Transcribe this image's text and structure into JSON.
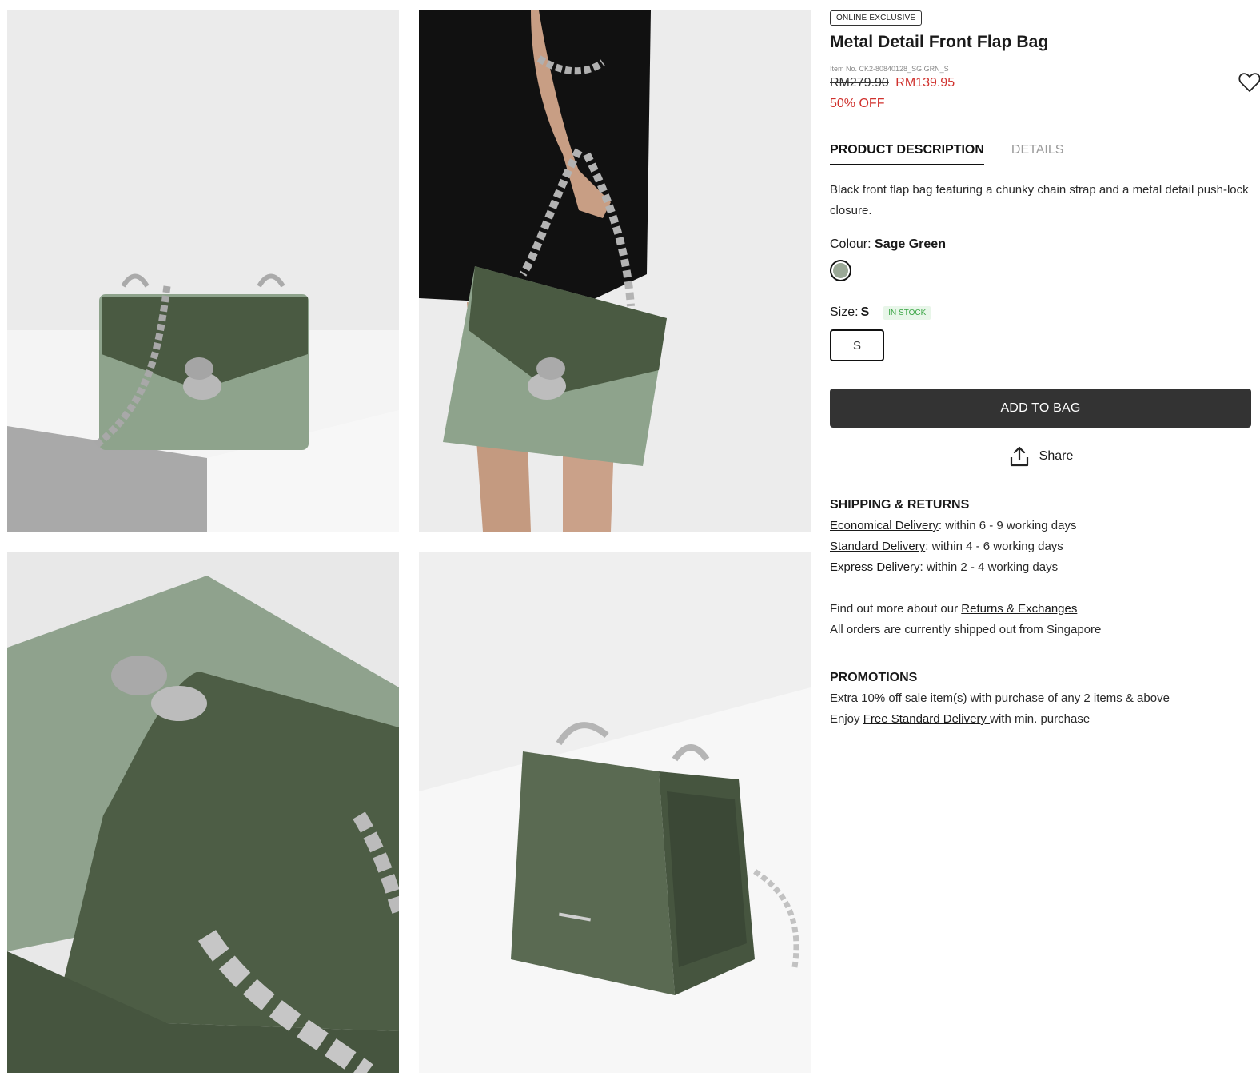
{
  "badge": "ONLINE EXCLUSIVE",
  "title": "Metal Detail Front Flap Bag",
  "item_no": "Item No. CK2-80840128_SG.GRN_S",
  "price": {
    "old": "RM279.90",
    "new": "RM139.95",
    "discount": "50% OFF"
  },
  "tabs": [
    {
      "label": "PRODUCT DESCRIPTION",
      "active": true
    },
    {
      "label": "DETAILS",
      "active": false
    }
  ],
  "description": "Black front flap bag featuring a chunky chain strap and a metal detail push-lock closure.",
  "colour": {
    "label": "Colour:",
    "value": "Sage Green",
    "swatch_hex": "#9aa896"
  },
  "size": {
    "label": "Size:",
    "value": "S",
    "stock": "IN STOCK",
    "option": "S"
  },
  "add_to_bag": "ADD TO BAG",
  "share": "Share",
  "shipping": {
    "title": "SHIPPING & RETURNS",
    "economical_link": "Economical Delivery",
    "economical_text": ": within 6 - 9 working days",
    "standard_link": "Standard Delivery",
    "standard_text": ": within 4 - 6 working days",
    "express_link": "Express Delivery",
    "express_text": ": within 2 - 4 working days",
    "returns_prefix": "Find out more about our ",
    "returns_link": "Returns & Exchanges",
    "shipped_from": "All orders are currently shipped out from Singapore"
  },
  "promotions": {
    "title": "PROMOTIONS",
    "line1": "Extra 10% off sale item(s) with purchase of any 2 items & above",
    "line2_prefix": "Enjoy ",
    "line2_link": "Free Standard Delivery ",
    "line2_suffix": "with min. purchase"
  },
  "icons": {
    "wishlist": "heart-icon",
    "share": "share-upload-icon"
  },
  "colors": {
    "sale_red": "#d0312d",
    "button_dark": "#333333",
    "in_stock_green": "#3aa545"
  }
}
